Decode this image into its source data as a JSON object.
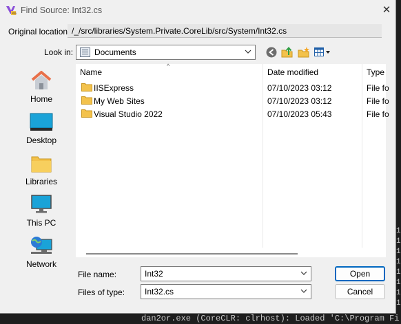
{
  "window": {
    "title": "Find Source: Int32.cs",
    "close_glyph": "✕"
  },
  "original_location": {
    "label": "Original location:",
    "value": "/_/src/libraries/System.Private.CoreLib/src/System/Int32.cs"
  },
  "look_in": {
    "label": "Look in:",
    "value": "Documents"
  },
  "toolbar": {
    "icons": [
      "back-icon",
      "up-folder-icon",
      "new-folder-icon",
      "view-menu-icon"
    ]
  },
  "places": [
    {
      "label": "Home",
      "icon": "home-icon"
    },
    {
      "label": "Desktop",
      "icon": "desktop-icon"
    },
    {
      "label": "Libraries",
      "icon": "libraries-icon"
    },
    {
      "label": "This PC",
      "icon": "this-pc-icon"
    },
    {
      "label": "Network",
      "icon": "network-icon"
    }
  ],
  "file_list": {
    "columns": {
      "name": "Name",
      "date": "Date modified",
      "type": "Type"
    },
    "rows": [
      {
        "name": "IISExpress",
        "date": "07/10/2023 03:12",
        "type": "File fo"
      },
      {
        "name": "My Web Sites",
        "date": "07/10/2023 03:12",
        "type": "File fo"
      },
      {
        "name": "Visual Studio 2022",
        "date": "07/10/2023 05:43",
        "type": "File fo"
      }
    ]
  },
  "file_name": {
    "label": "File name:",
    "value": "Int32"
  },
  "files_of_type": {
    "label": "Files of type:",
    "value": "Int32.cs"
  },
  "buttons": {
    "open": "Open",
    "cancel": "Cancel"
  },
  "background": {
    "console_line": "dan2or.exe  (CoreCLR: clrhost): Loaded 'C:\\Program Fi",
    "margin_marks": [
      "1",
      "1",
      "1",
      "1",
      "1",
      "1",
      "1",
      "1"
    ]
  },
  "colors": {
    "folder": "#f3c24c",
    "accent": "#0067c0",
    "home_roof": "#e8704a"
  }
}
